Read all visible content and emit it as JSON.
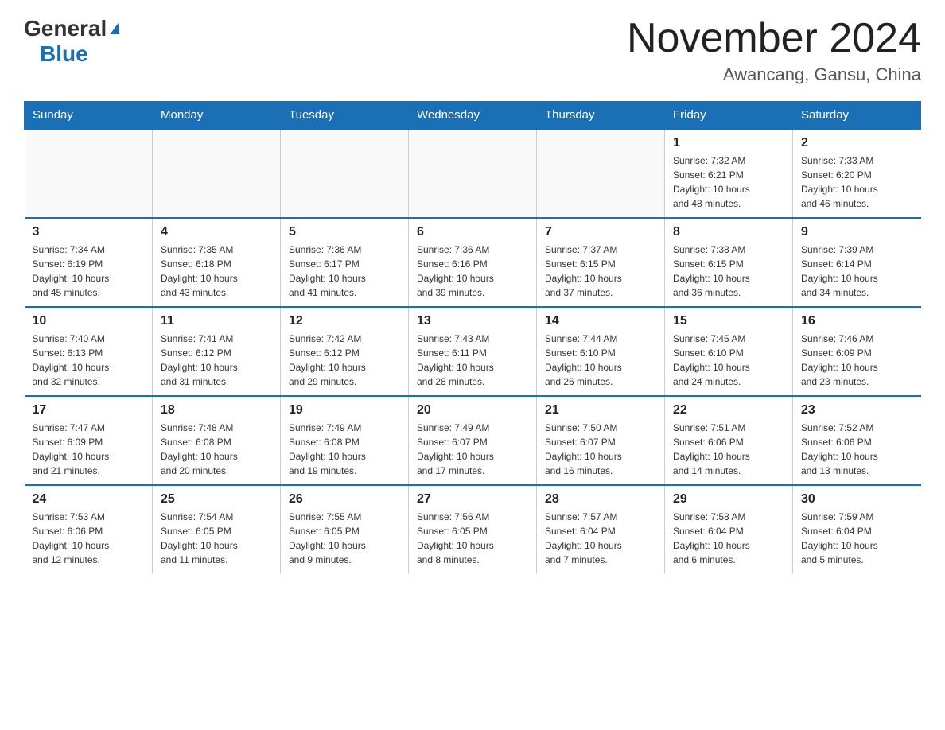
{
  "header": {
    "logo_general": "General",
    "logo_blue": "Blue",
    "month_year": "November 2024",
    "location": "Awancang, Gansu, China"
  },
  "days_of_week": [
    "Sunday",
    "Monday",
    "Tuesday",
    "Wednesday",
    "Thursday",
    "Friday",
    "Saturday"
  ],
  "weeks": [
    [
      {
        "day": "",
        "info": ""
      },
      {
        "day": "",
        "info": ""
      },
      {
        "day": "",
        "info": ""
      },
      {
        "day": "",
        "info": ""
      },
      {
        "day": "",
        "info": ""
      },
      {
        "day": "1",
        "info": "Sunrise: 7:32 AM\nSunset: 6:21 PM\nDaylight: 10 hours\nand 48 minutes."
      },
      {
        "day": "2",
        "info": "Sunrise: 7:33 AM\nSunset: 6:20 PM\nDaylight: 10 hours\nand 46 minutes."
      }
    ],
    [
      {
        "day": "3",
        "info": "Sunrise: 7:34 AM\nSunset: 6:19 PM\nDaylight: 10 hours\nand 45 minutes."
      },
      {
        "day": "4",
        "info": "Sunrise: 7:35 AM\nSunset: 6:18 PM\nDaylight: 10 hours\nand 43 minutes."
      },
      {
        "day": "5",
        "info": "Sunrise: 7:36 AM\nSunset: 6:17 PM\nDaylight: 10 hours\nand 41 minutes."
      },
      {
        "day": "6",
        "info": "Sunrise: 7:36 AM\nSunset: 6:16 PM\nDaylight: 10 hours\nand 39 minutes."
      },
      {
        "day": "7",
        "info": "Sunrise: 7:37 AM\nSunset: 6:15 PM\nDaylight: 10 hours\nand 37 minutes."
      },
      {
        "day": "8",
        "info": "Sunrise: 7:38 AM\nSunset: 6:15 PM\nDaylight: 10 hours\nand 36 minutes."
      },
      {
        "day": "9",
        "info": "Sunrise: 7:39 AM\nSunset: 6:14 PM\nDaylight: 10 hours\nand 34 minutes."
      }
    ],
    [
      {
        "day": "10",
        "info": "Sunrise: 7:40 AM\nSunset: 6:13 PM\nDaylight: 10 hours\nand 32 minutes."
      },
      {
        "day": "11",
        "info": "Sunrise: 7:41 AM\nSunset: 6:12 PM\nDaylight: 10 hours\nand 31 minutes."
      },
      {
        "day": "12",
        "info": "Sunrise: 7:42 AM\nSunset: 6:12 PM\nDaylight: 10 hours\nand 29 minutes."
      },
      {
        "day": "13",
        "info": "Sunrise: 7:43 AM\nSunset: 6:11 PM\nDaylight: 10 hours\nand 28 minutes."
      },
      {
        "day": "14",
        "info": "Sunrise: 7:44 AM\nSunset: 6:10 PM\nDaylight: 10 hours\nand 26 minutes."
      },
      {
        "day": "15",
        "info": "Sunrise: 7:45 AM\nSunset: 6:10 PM\nDaylight: 10 hours\nand 24 minutes."
      },
      {
        "day": "16",
        "info": "Sunrise: 7:46 AM\nSunset: 6:09 PM\nDaylight: 10 hours\nand 23 minutes."
      }
    ],
    [
      {
        "day": "17",
        "info": "Sunrise: 7:47 AM\nSunset: 6:09 PM\nDaylight: 10 hours\nand 21 minutes."
      },
      {
        "day": "18",
        "info": "Sunrise: 7:48 AM\nSunset: 6:08 PM\nDaylight: 10 hours\nand 20 minutes."
      },
      {
        "day": "19",
        "info": "Sunrise: 7:49 AM\nSunset: 6:08 PM\nDaylight: 10 hours\nand 19 minutes."
      },
      {
        "day": "20",
        "info": "Sunrise: 7:49 AM\nSunset: 6:07 PM\nDaylight: 10 hours\nand 17 minutes."
      },
      {
        "day": "21",
        "info": "Sunrise: 7:50 AM\nSunset: 6:07 PM\nDaylight: 10 hours\nand 16 minutes."
      },
      {
        "day": "22",
        "info": "Sunrise: 7:51 AM\nSunset: 6:06 PM\nDaylight: 10 hours\nand 14 minutes."
      },
      {
        "day": "23",
        "info": "Sunrise: 7:52 AM\nSunset: 6:06 PM\nDaylight: 10 hours\nand 13 minutes."
      }
    ],
    [
      {
        "day": "24",
        "info": "Sunrise: 7:53 AM\nSunset: 6:06 PM\nDaylight: 10 hours\nand 12 minutes."
      },
      {
        "day": "25",
        "info": "Sunrise: 7:54 AM\nSunset: 6:05 PM\nDaylight: 10 hours\nand 11 minutes."
      },
      {
        "day": "26",
        "info": "Sunrise: 7:55 AM\nSunset: 6:05 PM\nDaylight: 10 hours\nand 9 minutes."
      },
      {
        "day": "27",
        "info": "Sunrise: 7:56 AM\nSunset: 6:05 PM\nDaylight: 10 hours\nand 8 minutes."
      },
      {
        "day": "28",
        "info": "Sunrise: 7:57 AM\nSunset: 6:04 PM\nDaylight: 10 hours\nand 7 minutes."
      },
      {
        "day": "29",
        "info": "Sunrise: 7:58 AM\nSunset: 6:04 PM\nDaylight: 10 hours\nand 6 minutes."
      },
      {
        "day": "30",
        "info": "Sunrise: 7:59 AM\nSunset: 6:04 PM\nDaylight: 10 hours\nand 5 minutes."
      }
    ]
  ]
}
